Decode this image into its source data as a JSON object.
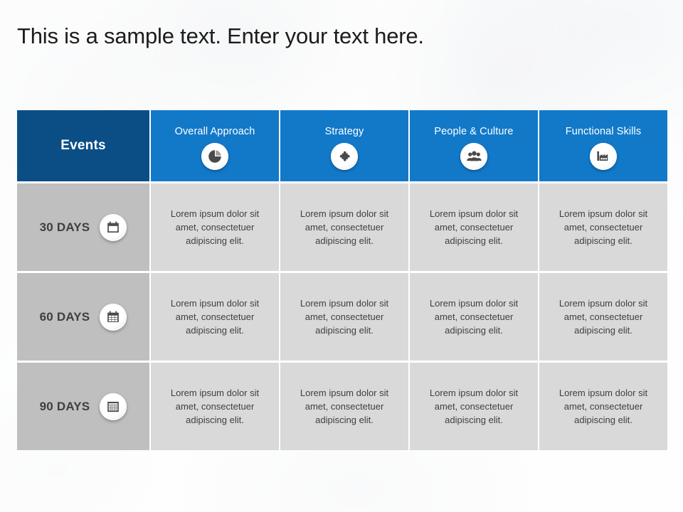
{
  "slide": {
    "title": "This is a sample text. Enter your text here."
  },
  "table": {
    "corner_header": {
      "label": "Events"
    },
    "columns": [
      {
        "label": "Overall Approach",
        "icon": "pie-chart-icon"
      },
      {
        "label": "Strategy",
        "icon": "puzzle-piece-icon"
      },
      {
        "label": "People & Culture",
        "icon": "people-group-icon"
      },
      {
        "label": "Functional Skills",
        "icon": "factory-icon"
      }
    ],
    "rows": [
      {
        "label": "30 DAYS",
        "icon": "calendar-icon",
        "cells": [
          "Lorem ipsum dolor sit amet, consectetuer adipiscing elit.",
          "Lorem ipsum dolor sit amet, consectetuer adipiscing elit.",
          "Lorem ipsum dolor sit amet, consectetuer adipiscing elit.",
          "Lorem ipsum dolor sit amet, consectetuer adipiscing elit."
        ]
      },
      {
        "label": "60 DAYS",
        "icon": "calendar-grid-icon",
        "cells": [
          "Lorem ipsum dolor sit amet, consectetuer adipiscing elit.",
          "Lorem ipsum dolor sit amet, consectetuer adipiscing elit.",
          "Lorem ipsum dolor sit amet, consectetuer adipiscing elit.",
          "Lorem ipsum dolor sit amet, consectetuer adipiscing elit."
        ]
      },
      {
        "label": "90 DAYS",
        "icon": "calendar-month-icon",
        "cells": [
          "Lorem ipsum dolor sit amet, consectetuer adipiscing elit.",
          "Lorem ipsum dolor sit amet, consectetuer adipiscing elit.",
          "Lorem ipsum dolor sit amet, consectetuer adipiscing elit.",
          "Lorem ipsum dolor sit amet, consectetuer adipiscing elit."
        ]
      }
    ]
  },
  "colors": {
    "header_dark_blue": "#0b4e86",
    "header_blue": "#1279c9",
    "row_label_gray": "#bfbfbf",
    "cell_gray": "#d9d9d9",
    "text_dark": "#3f3f3f",
    "title_text": "#1c1c1c",
    "icon_dark": "#4a4a4a"
  }
}
